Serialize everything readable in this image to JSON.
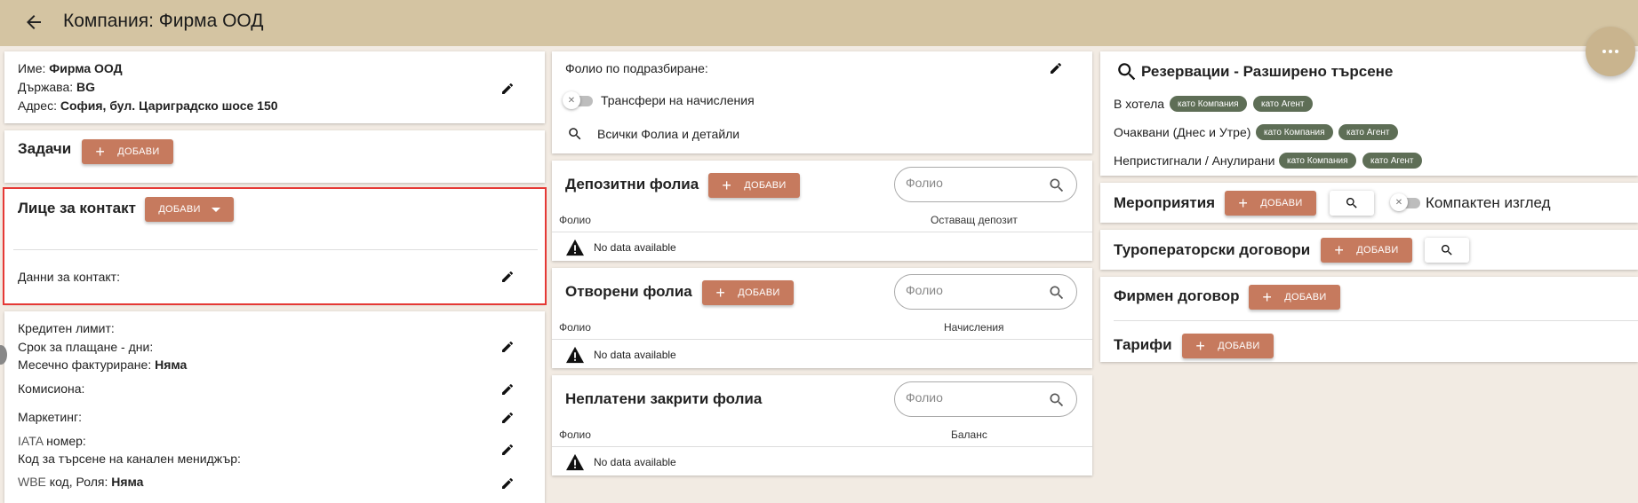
{
  "header": {
    "title": "Компания: Фирма ООД",
    "icons": {
      "back": "arrow-left-icon",
      "more": "more-horizontal-icon"
    }
  },
  "colors": {
    "topbar": "#d4c4a2",
    "accent_button": "#c67a5e",
    "chip": "#5e6e56",
    "highlight_border": "#e53935",
    "background": "#f2ebe3"
  },
  "add_label": "ДОБАВИ",
  "company": {
    "name_label": "Име:",
    "name_value": "Фирма ООД",
    "country_label": "Държава:",
    "country_value": "BG",
    "address_label": "Адрес:",
    "address_value": "София, бул. Цариградско шосе 150"
  },
  "tasks": {
    "title": "Задачи"
  },
  "contact": {
    "title": "Лице за контакт",
    "details_label": "Данни за контакт:"
  },
  "billing": {
    "credit_limit_label": "Кредитен лимит:",
    "payment_days_label": "Срок за плащане - дни:",
    "monthly_invoicing_label": "Месечно фактуриране:",
    "monthly_invoicing_value": "Няма",
    "commission_label": "Комисиона:",
    "marketing_label": "Маркетинг:",
    "iata_prefix": "IATA",
    "iata_suffix": "номер:",
    "channel_manager_label": "Код за търсене на канален мениджър:",
    "wbe_prefix": "WBE",
    "wbe_suffix": "код, Роля:",
    "wbe_value": "Няма"
  },
  "folio_settings": {
    "default_folio_label": "Фолио по подразбиране:",
    "transfer_label": "Трансфери на начисления",
    "all_folios_label": "Всички Фолиа и детайли"
  },
  "deposit_folios": {
    "title": "Депозитни фолиа",
    "search_placeholder": "Фолио",
    "columns": [
      "Фолио",
      "Оставащ депозит"
    ],
    "empty_text": "No data available"
  },
  "open_folios": {
    "title": "Отворени фолиа",
    "search_placeholder": "Фолио",
    "columns": [
      "Фолио",
      "Начисления"
    ],
    "empty_text": "No data available"
  },
  "unpaid_folios": {
    "title": "Неплатени закрити фолиа",
    "search_placeholder": "Фолио",
    "columns": [
      "Фолио",
      "Баланс"
    ],
    "empty_text": "No data available"
  },
  "reservations": {
    "title": "Резервации - Разширено търсене",
    "rows": [
      {
        "label": "В хотела",
        "chips": [
          "като Компания",
          "като Агент"
        ]
      },
      {
        "label": "Очаквани (Днес и Утре)",
        "chips": [
          "като Компания",
          "като Агент"
        ]
      },
      {
        "label": "Непристигнали / Анулирани",
        "chips": [
          "като Компания",
          "като Агент"
        ]
      }
    ]
  },
  "events": {
    "title": "Мероприятия",
    "compact_label": "Компактен изглед"
  },
  "tour_contracts": {
    "title": "Туроператорски договори"
  },
  "company_contract": {
    "title": "Фирмен договор"
  },
  "tariffs": {
    "title": "Тарифи"
  }
}
